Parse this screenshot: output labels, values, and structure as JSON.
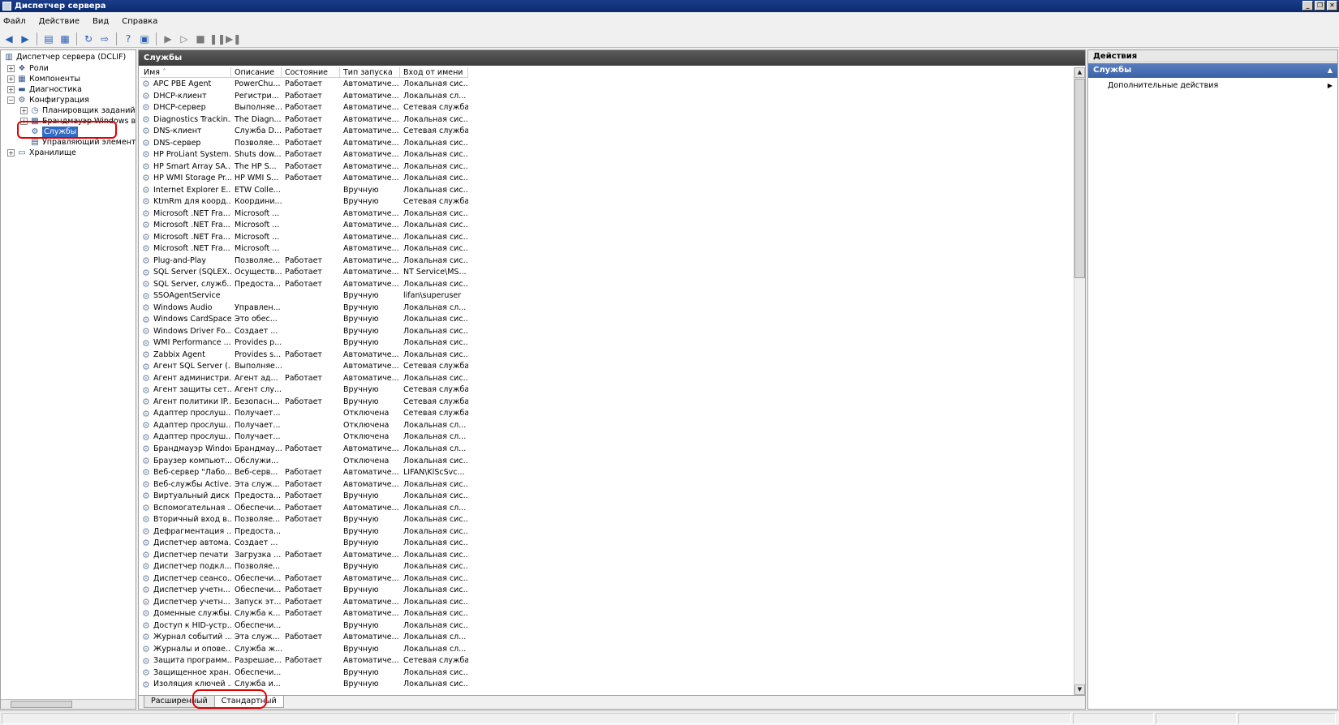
{
  "window": {
    "title": "Диспетчер сервера"
  },
  "menu": [
    "Файл",
    "Действие",
    "Вид",
    "Справка"
  ],
  "tree": {
    "root": "Диспетчер сервера (DCLIF)",
    "roles": "Роли",
    "components": "Компоненты",
    "diagnostics": "Диагностика",
    "configuration": "Конфигурация",
    "task_scheduler": "Планировщик заданий",
    "firewall": "Брандмауэр Windows в ре",
    "services": "Службы",
    "wmi": "Управляющий элемент W",
    "storage": "Хранилище"
  },
  "center": {
    "title": "Службы",
    "columns": [
      "Имя",
      "Описание",
      "Состояние",
      "Тип запуска",
      "Вход от имени"
    ],
    "rows": [
      [
        "APC PBE Agent",
        "PowerChu...",
        "Работает",
        "Автоматиче...",
        "Локальная сис..."
      ],
      [
        "DHCP-клиент",
        "Регистри...",
        "Работает",
        "Автоматиче...",
        "Локальная сл..."
      ],
      [
        "DHCP-сервер",
        "Выполняе...",
        "Работает",
        "Автоматиче...",
        "Сетевая служба"
      ],
      [
        "Diagnostics Trackin...",
        "The Diagn...",
        "Работает",
        "Автоматиче...",
        "Локальная сис..."
      ],
      [
        "DNS-клиент",
        "Служба D...",
        "Работает",
        "Автоматиче...",
        "Сетевая служба"
      ],
      [
        "DNS-сервер",
        "Позволяе...",
        "Работает",
        "Автоматиче...",
        "Локальная сис..."
      ],
      [
        "HP ProLiant System...",
        "Shuts dow...",
        "Работает",
        "Автоматиче...",
        "Локальная сис..."
      ],
      [
        "HP Smart Array SA...",
        "The HP S...",
        "Работает",
        "Автоматиче...",
        "Локальная сис..."
      ],
      [
        "HP WMI Storage Pr...",
        "HP WMI S...",
        "Работает",
        "Автоматиче...",
        "Локальная сис..."
      ],
      [
        "Internet Explorer E...",
        "ETW Colle...",
        "",
        "Вручную",
        "Локальная сис..."
      ],
      [
        "KtmRm для коорд...",
        "Координи...",
        "",
        "Вручную",
        "Сетевая служба"
      ],
      [
        "Microsoft .NET Fra...",
        "Microsoft ...",
        "",
        "Автоматиче...",
        "Локальная сис..."
      ],
      [
        "Microsoft .NET Fra...",
        "Microsoft ...",
        "",
        "Автоматиче...",
        "Локальная сис..."
      ],
      [
        "Microsoft .NET Fra...",
        "Microsoft ...",
        "",
        "Автоматиче...",
        "Локальная сис..."
      ],
      [
        "Microsoft .NET Fra...",
        "Microsoft ...",
        "",
        "Автоматиче...",
        "Локальная сис..."
      ],
      [
        "Plug-and-Play",
        "Позволяе...",
        "Работает",
        "Автоматиче...",
        "Локальная сис..."
      ],
      [
        "SQL Server (SQLEX...",
        "Осуществ...",
        "Работает",
        "Автоматиче...",
        "NT Service\\MS..."
      ],
      [
        "SQL Server, служб...",
        "Предоста...",
        "Работает",
        "Автоматиче...",
        "Локальная сис..."
      ],
      [
        "SSOAgentService",
        "",
        "",
        "Вручную",
        "lifan\\superuser"
      ],
      [
        "Windows Audio",
        "Управлен...",
        "",
        "Вручную",
        "Локальная сл..."
      ],
      [
        "Windows CardSpace",
        "Это обес...",
        "",
        "Вручную",
        "Локальная сис..."
      ],
      [
        "Windows Driver Fo...",
        "Создает ...",
        "",
        "Вручную",
        "Локальная сис..."
      ],
      [
        "WMI Performance ...",
        "Provides p...",
        "",
        "Вручную",
        "Локальная сис..."
      ],
      [
        "Zabbix Agent",
        "Provides s...",
        "Работает",
        "Автоматиче...",
        "Локальная сис..."
      ],
      [
        "Агент SQL Server (...",
        "Выполняе...",
        "",
        "Автоматиче...",
        "Сетевая служба"
      ],
      [
        "Агент администри...",
        "Агент ад...",
        "Работает",
        "Автоматиче...",
        "Локальная сис..."
      ],
      [
        "Агент защиты сет...",
        "Агент слу...",
        "",
        "Вручную",
        "Сетевая служба"
      ],
      [
        "Агент политики IP...",
        "Безопасн...",
        "Работает",
        "Вручную",
        "Сетевая служба"
      ],
      [
        "Адаптер прослуш...",
        "Получает...",
        "",
        "Отключена",
        "Сетевая служба"
      ],
      [
        "Адаптер прослуш...",
        "Получает...",
        "",
        "Отключена",
        "Локальная сл..."
      ],
      [
        "Адаптер прослуш...",
        "Получает...",
        "",
        "Отключена",
        "Локальная сл..."
      ],
      [
        "Брандмауэр Windows",
        "Брандмау...",
        "Работает",
        "Автоматиче...",
        "Локальная сл..."
      ],
      [
        "Браузер компьют...",
        "Обслужи...",
        "",
        "Отключена",
        "Локальная сис..."
      ],
      [
        "Веб-сервер \"Лабо...",
        "Веб-серв...",
        "Работает",
        "Автоматиче...",
        "LIFAN\\KlScSvc..."
      ],
      [
        "Веб-службы Active...",
        "Эта служ...",
        "Работает",
        "Автоматиче...",
        "Локальная сис..."
      ],
      [
        "Виртуальный диск",
        "Предоста...",
        "Работает",
        "Вручную",
        "Локальная сис..."
      ],
      [
        "Вспомогательная ...",
        "Обеспечи...",
        "Работает",
        "Автоматиче...",
        "Локальная сл..."
      ],
      [
        "Вторичный вход в...",
        "Позволяе...",
        "Работает",
        "Вручную",
        "Локальная сис..."
      ],
      [
        "Дефрагментация ...",
        "Предоста...",
        "",
        "Вручную",
        "Локальная сис..."
      ],
      [
        "Диспетчер автома...",
        "Создает ...",
        "",
        "Вручную",
        "Локальная сис..."
      ],
      [
        "Диспетчер печати",
        "Загрузка ...",
        "Работает",
        "Автоматиче...",
        "Локальная сис..."
      ],
      [
        "Диспетчер подкл...",
        "Позволяе...",
        "",
        "Вручную",
        "Локальная сис..."
      ],
      [
        "Диспетчер сеансо...",
        "Обеспечи...",
        "Работает",
        "Автоматиче...",
        "Локальная сис..."
      ],
      [
        "Диспетчер учетн...",
        "Обеспечи...",
        "Работает",
        "Вручную",
        "Локальная сис..."
      ],
      [
        "Диспетчер учетн...",
        "Запуск эт...",
        "Работает",
        "Автоматиче...",
        "Локальная сис..."
      ],
      [
        "Доменные службы...",
        "Служба к...",
        "Работает",
        "Автоматиче...",
        "Локальная сис..."
      ],
      [
        "Доступ к HID-устр...",
        "Обеспечи...",
        "",
        "Вручную",
        "Локальная сис..."
      ],
      [
        "Журнал событий ...",
        "Эта служ...",
        "Работает",
        "Автоматиче...",
        "Локальная сл..."
      ],
      [
        "Журналы и опове...",
        "Служба ж...",
        "",
        "Вручную",
        "Локальная сл..."
      ],
      [
        "Защита программ...",
        "Разрешае...",
        "Работает",
        "Автоматиче...",
        "Сетевая служба"
      ],
      [
        "Защищенное хран...",
        "Обеспечи...",
        "",
        "Вручную",
        "Локальная сис..."
      ],
      [
        "Изоляция ключей ...",
        "Служба и...",
        "",
        "Вручную",
        "Локальная сис..."
      ]
    ],
    "tabs": [
      "Расширенный",
      "Стандартный"
    ]
  },
  "actions": {
    "title": "Действия",
    "group": "Службы",
    "more": "Дополнительные действия"
  },
  "colors": {
    "titlebar": "#0b2a6e",
    "selection": "#316ac5",
    "highlight": "#e00000"
  }
}
